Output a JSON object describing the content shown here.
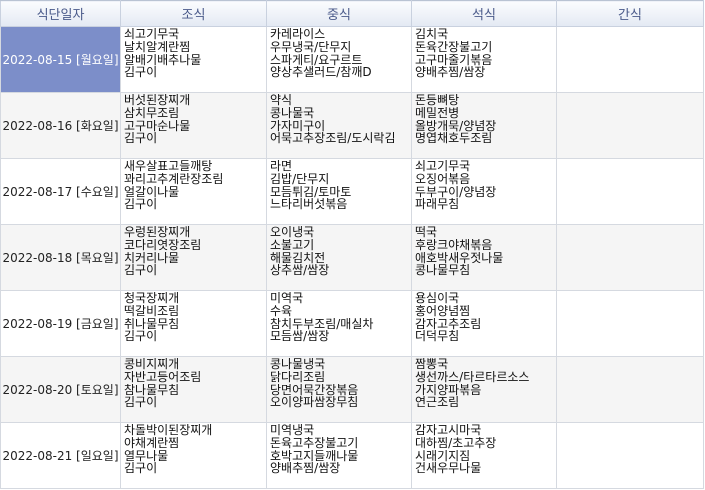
{
  "headers": [
    "식단일자",
    "조식",
    "중식",
    "석식",
    "간식"
  ],
  "rows": [
    {
      "date": "2022-08-15 [월요일]",
      "selected": true,
      "breakfast": [
        "쇠고기무국",
        "날치알계란찜",
        "알배기배추나물",
        "김구이"
      ],
      "lunch": [
        "카레라이스",
        "우무냉국/단무지",
        "스파게티/요구르트",
        "양상추샐러드/참깨D"
      ],
      "dinner": [
        "김치국",
        "돈육간장불고기",
        "고구마줄기볶음",
        "양배추찜/쌈장"
      ],
      "snack": []
    },
    {
      "date": "2022-08-16 [화요일]",
      "selected": false,
      "breakfast": [
        "버섯된장찌개",
        "삼치무조림",
        "고구마순나물",
        "김구이"
      ],
      "lunch": [
        "약식",
        "콩나물국",
        "가자미구이",
        "어묵고추장조림/도시락김"
      ],
      "dinner": [
        "돈등뼈탕",
        "메밀전병",
        "올방개묵/양념장",
        "명엽채호두조림"
      ],
      "snack": []
    },
    {
      "date": "2022-08-17 [수요일]",
      "selected": false,
      "breakfast": [
        "새우살표고들깨탕",
        "꽈리고추계란장조림",
        "얼갈이나물",
        "김구이"
      ],
      "lunch": [
        "라면",
        "김밥/단무지",
        "모듬튀김/토마토",
        "느타리버섯볶음"
      ],
      "dinner": [
        "쇠고기무국",
        "오징어볶음",
        "두부구이/양념장",
        "파래무침"
      ],
      "snack": []
    },
    {
      "date": "2022-08-18 [목요일]",
      "selected": false,
      "breakfast": [
        "우렁된장찌개",
        "코다리엿장조림",
        "치커리나물",
        "김구이"
      ],
      "lunch": [
        "오이냉국",
        "소불고기",
        "해물김치전",
        "상추쌈/쌈장"
      ],
      "dinner": [
        "떡국",
        "후랑크야채볶음",
        "애호박새우젓나물",
        "콩나물무침"
      ],
      "snack": []
    },
    {
      "date": "2022-08-19 [금요일]",
      "selected": false,
      "breakfast": [
        "청국장찌개",
        "떡갈비조림",
        "취나물무침",
        "김구이"
      ],
      "lunch": [
        "미역국",
        "수육",
        "참치두부조림/매실차",
        "모듬쌈/쌈장"
      ],
      "dinner": [
        "용심이국",
        "홍어양념찜",
        "감자고추조림",
        "더덕무침"
      ],
      "snack": []
    },
    {
      "date": "2022-08-20 [토요일]",
      "selected": false,
      "breakfast": [
        "콩비지찌개",
        "자반고등어조림",
        "참나물무침",
        "김구이"
      ],
      "lunch": [
        "콩나물냉국",
        "닭다리조림",
        "당면어묵간장볶음",
        "오이양파쌈장무침"
      ],
      "dinner": [
        "짬뽕국",
        "생선까스/타르타르소스",
        "가지양파볶음",
        "연근조림"
      ],
      "snack": []
    },
    {
      "date": "2022-08-21 [일요일]",
      "selected": false,
      "breakfast": [
        "차돌박이된장찌개",
        "야채계란찜",
        "열무나물",
        "김구이"
      ],
      "lunch": [
        "미역냉국",
        "돈육고추장불고기",
        "호박고지들깨나물",
        "양배추찜/쌈장"
      ],
      "dinner": [
        "감자고시마국",
        "대하찜/초고추장",
        "시래기지짐",
        "건새우무나물"
      ],
      "snack": []
    }
  ]
}
